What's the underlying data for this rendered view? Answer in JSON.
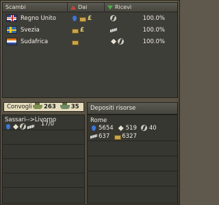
{
  "trade": {
    "headers": {
      "partner": "Scambi",
      "give": "Dai",
      "receive": "Ricevi"
    },
    "rows": [
      {
        "country": "Regno Unito",
        "flag": "uk-flag",
        "give_icons": [
          "oil-icon",
          "supply-icon",
          "money-icon"
        ],
        "receive_icons": [
          "energy-icon"
        ],
        "percent": "100.0%"
      },
      {
        "country": "Svezia",
        "flag": "sweden-flag",
        "give_icons": [
          "supply-icon",
          "money-icon"
        ],
        "receive_icons": [
          "metal-icon"
        ],
        "percent": "100.0%"
      },
      {
        "country": "Sudafrica",
        "flag": "south-africa-flag",
        "give_icons": [
          "supply-icon"
        ],
        "receive_icons": [
          "rare-materials-icon",
          "energy-icon"
        ],
        "percent": "100.0%"
      }
    ]
  },
  "convoys": {
    "tab_label": "Convogli",
    "transport_count": "263",
    "escort_count": "35",
    "routes": [
      {
        "route": "Sassari-->Livorno",
        "load": "17/0",
        "icons": [
          "oil-icon",
          "rare-materials-icon",
          "energy-icon",
          "metal-icon"
        ]
      }
    ]
  },
  "depots": {
    "tab_label": "Depositi risorse",
    "entries": [
      {
        "city": "Rome",
        "oil": "5654",
        "rare": "519",
        "energy": "40",
        "metal": "637",
        "supplies": "6327"
      }
    ]
  },
  "colors": {
    "panel": "#3e3e39",
    "tab_light": "#e6ddbd",
    "text": "#f2efe6",
    "accent_green": "#4fae45",
    "accent_red": "#c8443a"
  }
}
